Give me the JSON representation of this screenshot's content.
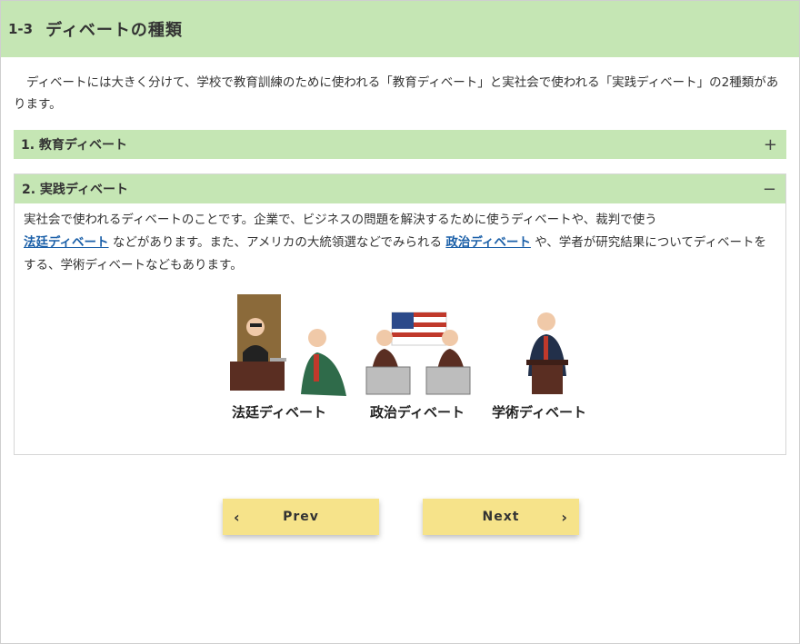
{
  "header": {
    "section_number": "1-3",
    "title": "ディベートの種類"
  },
  "intro": {
    "text": "ディベートには大きく分けて、学校で教育訓練のために使われる「教育ディベート」と実社会で使われる「実践ディベート」の2種類があります。"
  },
  "accordion": [
    {
      "label": "1. 教育ディベート",
      "sign": "+"
    },
    {
      "label": "2. 実践ディベート",
      "sign": "−"
    }
  ],
  "practical": {
    "text_1": "実社会で使われるディベートのことです。企業で、ビジネスの問題を解決するために使うディベートや、裁判で使う",
    "link_1": "法廷ディベート",
    "text_2": " などがあります。また、アメリカの大統領選などでみられる ",
    "link_2": "政治ディベート",
    "text_3": " や、学者が研究結果についてディベートをする、学術ディベートなどもあります。",
    "captions": {
      "court": "法廷ディベート",
      "politics": "政治ディベート",
      "academic": "学術ディベート"
    }
  },
  "nav": {
    "prev": "Prev",
    "next": "Next",
    "prev_arrow": "‹",
    "next_arrow": "›"
  },
  "colors": {
    "header_bg": "#c5e6b4",
    "button_bg": "#f6e38a",
    "link": "#1a5fa8"
  }
}
